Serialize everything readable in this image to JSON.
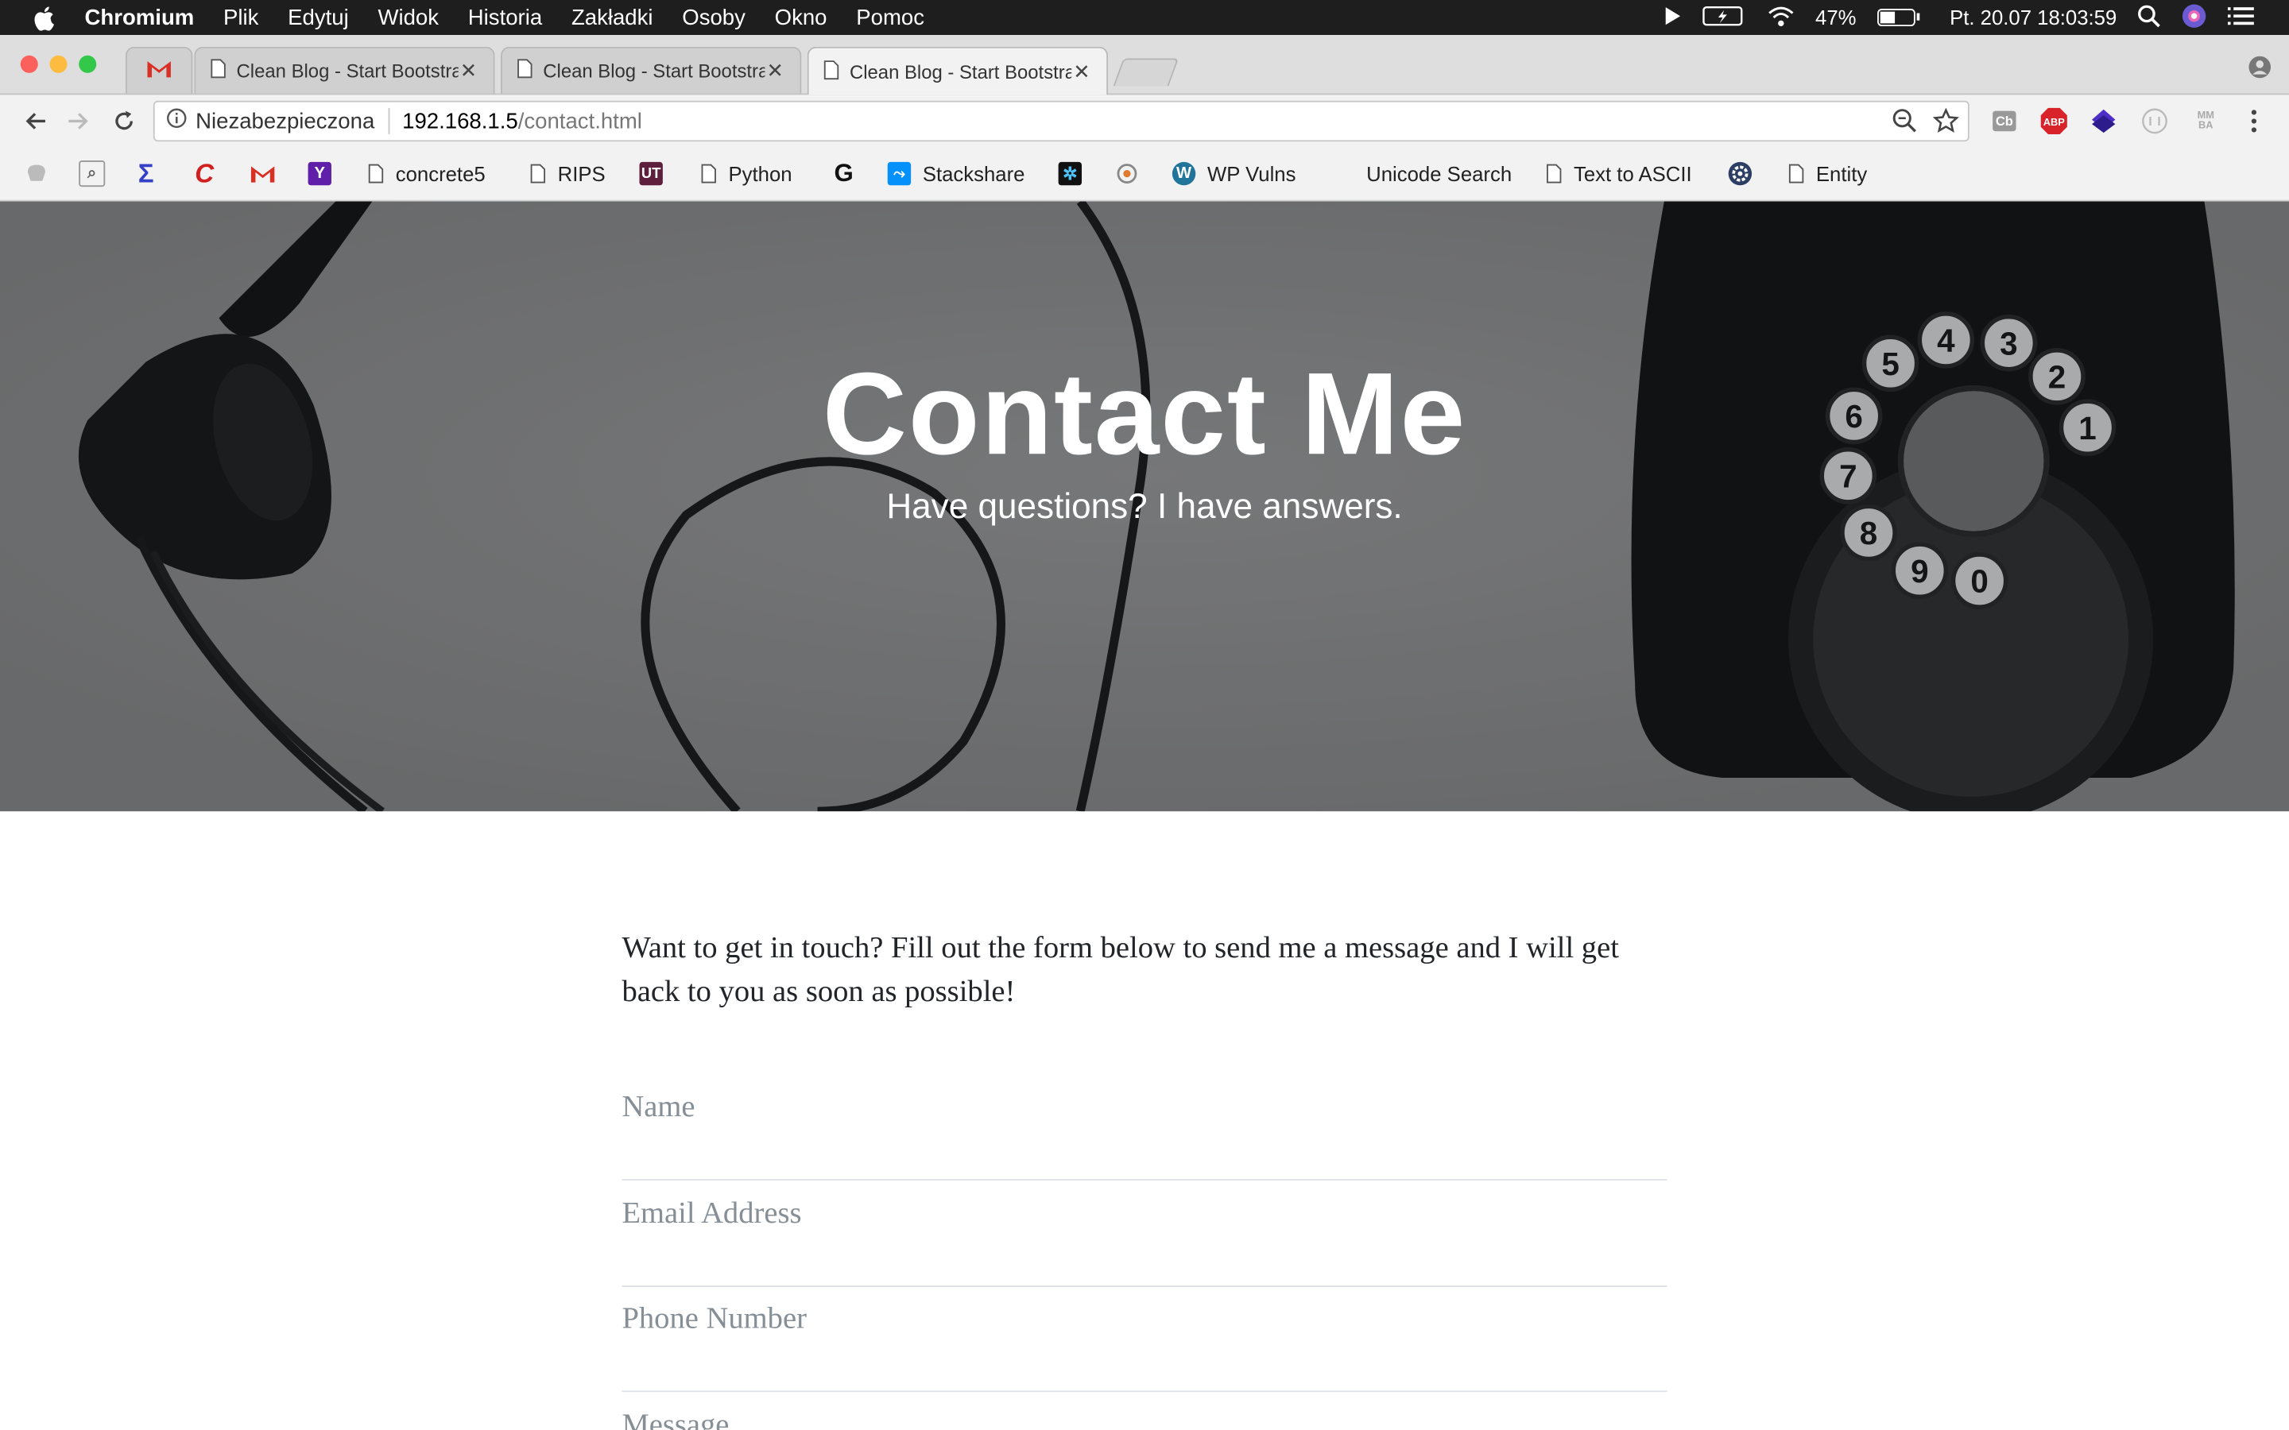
{
  "menubar": {
    "app_name": "Chromium",
    "menus": [
      "Plik",
      "Edytuj",
      "Widok",
      "Historia",
      "Zakładki",
      "Osoby",
      "Okno",
      "Pomoc"
    ],
    "battery_percent": "47%",
    "battery_level": 0.47,
    "datetime": "Pt. 20.07  18:03:59"
  },
  "tabs": [
    {
      "title": "Clean Blog - Start Bootstrap",
      "active": false
    },
    {
      "title": "Clean Blog - Start Bootstrap",
      "active": false
    },
    {
      "title": "Clean Blog - Start Bootstrap",
      "active": true
    }
  ],
  "address_bar": {
    "security_label": "Niezabezpieczona",
    "url_host": "192.168.1.5",
    "url_path": "/contact.html"
  },
  "bookmarks": [
    {
      "label": "concrete5"
    },
    {
      "label": "RIPS"
    },
    {
      "label": "Python"
    },
    {
      "label": "Stackshare"
    },
    {
      "label": "WP Vulns"
    },
    {
      "label": "Unicode Search"
    },
    {
      "label": "Text to ASCII"
    },
    {
      "label": "Entity"
    }
  ],
  "hero": {
    "title": "Contact Me",
    "subtitle": "Have questions? I have answers."
  },
  "main": {
    "intro": "Want to get in touch? Fill out the form below to send me a message and I will get back to you as soon as possible!",
    "form": {
      "name_placeholder": "Name",
      "email_placeholder": "Email Address",
      "phone_placeholder": "Phone Number",
      "message_placeholder": "Message"
    }
  },
  "colors": {
    "traffic_red": "#fc605c",
    "traffic_yellow": "#fdbc40",
    "traffic_green": "#34c84a",
    "abp_red": "#d8232a"
  }
}
